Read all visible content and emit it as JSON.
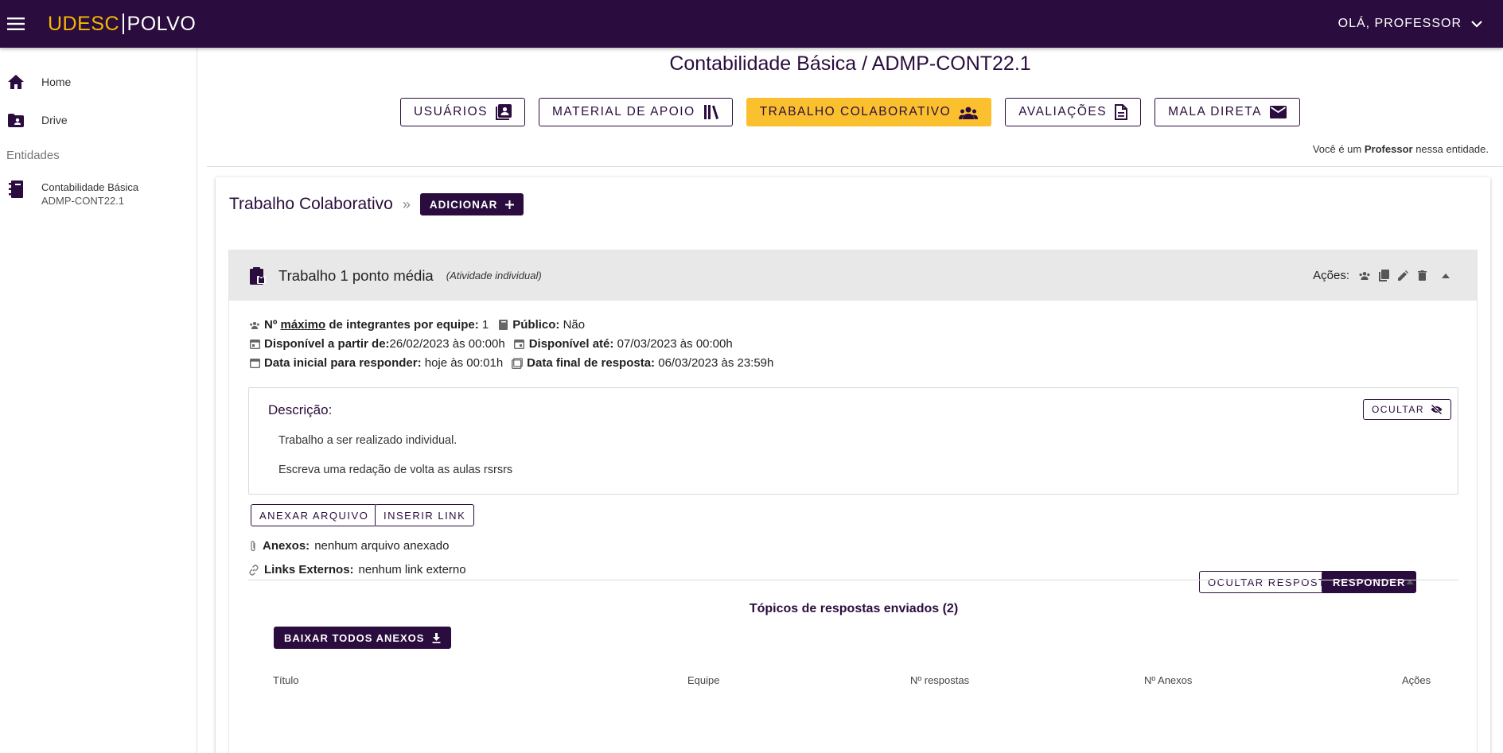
{
  "topbar": {
    "logo_left": "UDESC",
    "logo_right": "POLVO",
    "user_greeting": "OLÁ, PROFESSOR"
  },
  "sidebar": {
    "items": [
      {
        "label": "Home",
        "icon": "home-icon"
      },
      {
        "label": "Drive",
        "icon": "folder-shared-icon"
      }
    ],
    "section_header": "Entidades",
    "entity": {
      "name": "Contabilidade Básica",
      "code": "ADMP-CONT22.1",
      "icon": "notebook-icon"
    }
  },
  "main": {
    "title": "Contabilidade Básica / ADMP-CONT22.1",
    "tabs": [
      {
        "label": "USUÁRIOS",
        "icon": "contacts-icon",
        "active": false
      },
      {
        "label": "MATERIAL DE APOIO",
        "icon": "library-icon",
        "active": false
      },
      {
        "label": "TRABALHO COLABORATIVO",
        "icon": "group-icon",
        "active": true
      },
      {
        "label": "AVALIAÇÕES",
        "icon": "document-icon",
        "active": false
      },
      {
        "label": "MALA DIRETA",
        "icon": "mail-icon",
        "active": false
      }
    ],
    "role_prefix": "Você é um",
    "role": "Professor",
    "role_suffix": "nessa entidade."
  },
  "card": {
    "breadcrumb_title": "Trabalho Colaborativo",
    "breadcrumb_sep": "»",
    "add_button": "ADICIONAR",
    "activity": {
      "name": "Trabalho 1 ponto média",
      "kind": "(Atividade individual)",
      "actions_label": "Ações:",
      "max_label_a": "Nº",
      "max_label_b": "máximo",
      "max_label_c": "de integrantes por equipe:",
      "max_value": "1",
      "public_label": "Público:",
      "public_value": "Não",
      "available_from_label": "Disponível a partir de:",
      "available_from_value": "26/02/2023 às 00:00h",
      "available_until_label": "Disponível até:",
      "available_until_value": "07/03/2023 às 00:00h",
      "start_label": "Data inicial para responder:",
      "start_value": "hoje às 00:01h",
      "end_label": "Data final de resposta:",
      "end_value": "06/03/2023 às 23:59h",
      "description_title": "Descrição:",
      "hide_button": "OCULTAR",
      "description_lines": [
        "Trabalho a ser realizado individual.",
        "Escreva uma redação de volta as aulas rsrsrs"
      ],
      "attach_button": "ANEXAR ARQUIVO",
      "link_button": "INSERIR LINK",
      "attachments_label": "Anexos:",
      "attachments_value": "nenhum arquivo anexado",
      "ext_links_label": "Links Externos:",
      "ext_links_value": "nenhum link externo",
      "hide_answers_button": "OCULTAR RESPOSTAS",
      "answer_button": "RESPONDER",
      "topics_title": "Tópicos de respostas enviados (2)",
      "download_all_button": "BAIXAR TODOS ANEXOS",
      "table_headers": [
        "Título",
        "Equipe",
        "Nº respostas",
        "Nº Anexos",
        "Ações"
      ]
    }
  },
  "colors": {
    "brand_dark": "#2a0d3e",
    "brand_accent": "#f5b800",
    "active_tab": "#fbc02d"
  }
}
